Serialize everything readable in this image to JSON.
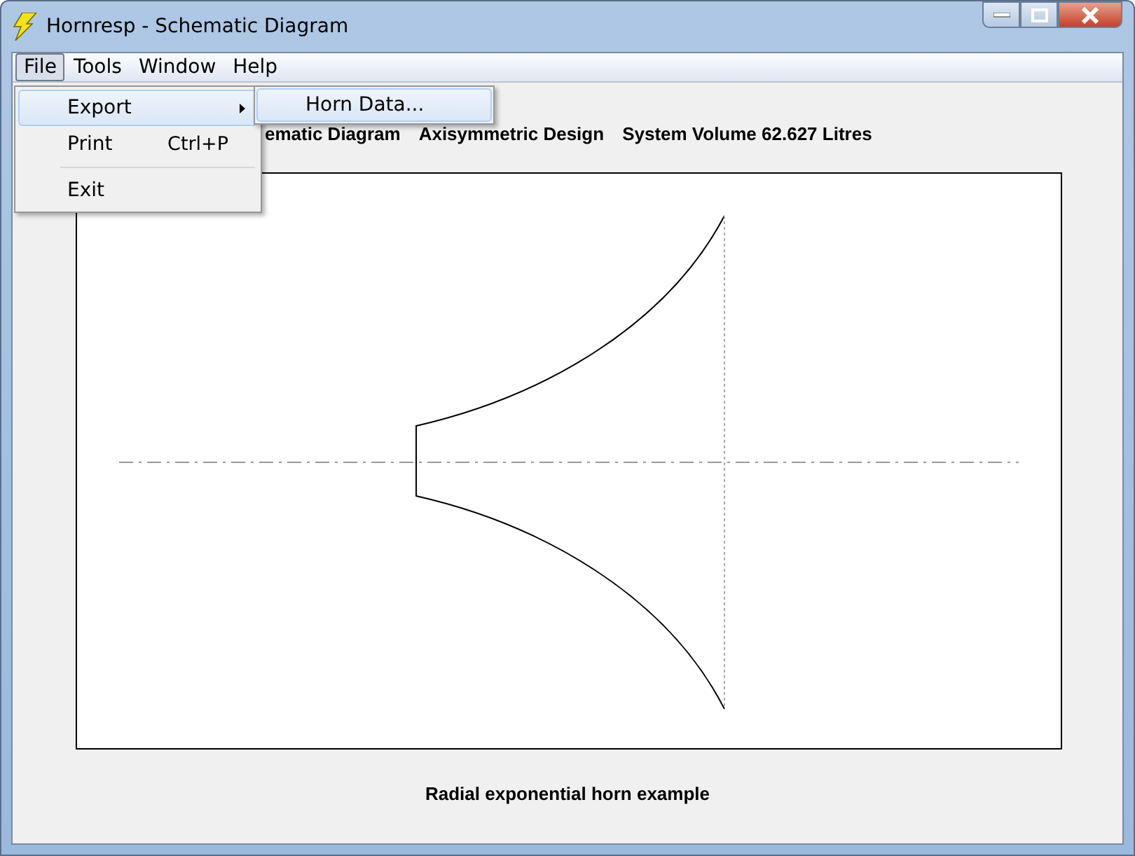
{
  "window": {
    "title": "Hornresp - Schematic Diagram"
  },
  "menu_bar": [
    {
      "label": "File",
      "selected": true
    },
    {
      "label": "Tools",
      "selected": false
    },
    {
      "label": "Window",
      "selected": false
    },
    {
      "label": "Help",
      "selected": false
    }
  ],
  "file_menu": [
    {
      "kind": "submenu",
      "label": "Export",
      "selected": true
    },
    {
      "kind": "item",
      "label": "Print",
      "shortcut": "Ctrl+P",
      "selected": false
    },
    {
      "kind": "separator"
    },
    {
      "kind": "item",
      "label": "Exit",
      "selected": false
    }
  ],
  "export_submenu": [
    {
      "label": "Horn Data...",
      "selected": true
    }
  ],
  "heading": [
    "ematic Diagram",
    "Axisymmetric Design",
    "System Volume 62.627 Litres"
  ],
  "caption": "Radial exponential horn example"
}
